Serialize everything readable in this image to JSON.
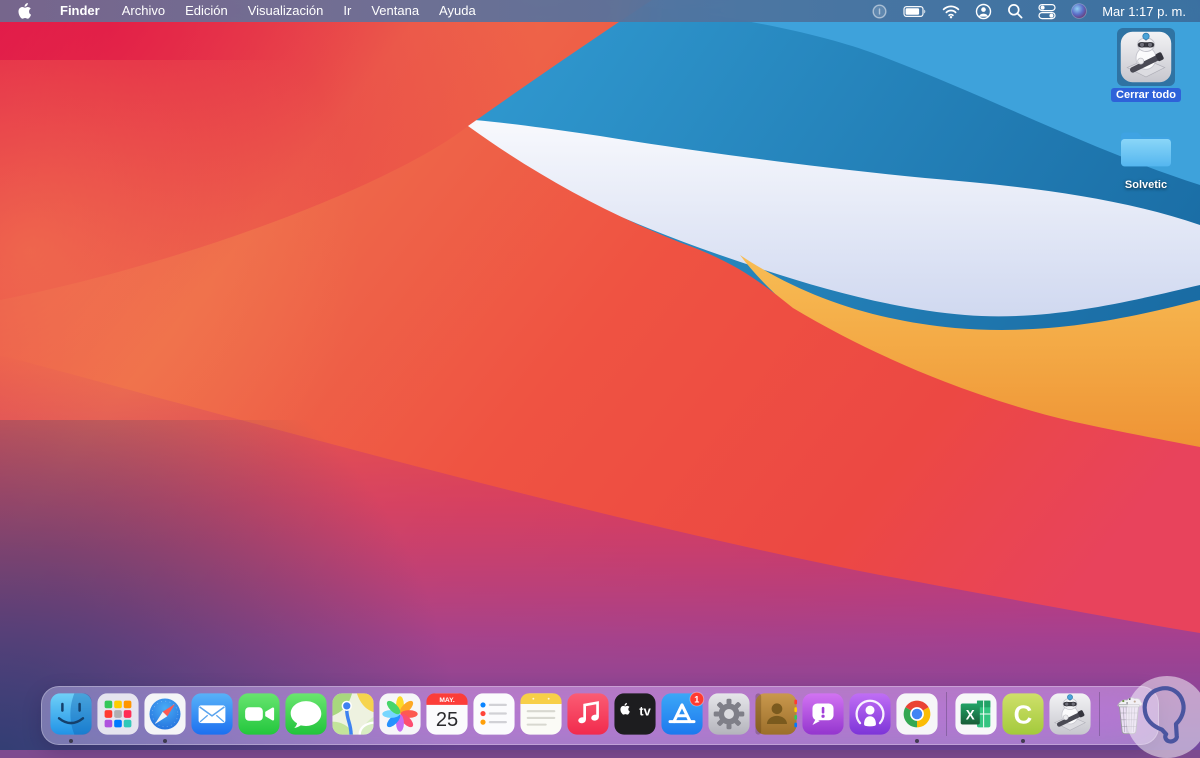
{
  "menubar": {
    "active_app": "Finder",
    "menus": [
      "Finder",
      "Archivo",
      "Edición",
      "Visualización",
      "Ir",
      "Ventana",
      "Ayuda"
    ],
    "status_icons": [
      "dimmed-status-icon",
      "battery-icon",
      "wifi-icon",
      "user-account-icon",
      "spotlight-search-icon",
      "control-center-icon",
      "siri-app-icon"
    ],
    "clock": "Mar 1:17 p. m."
  },
  "desktop": {
    "icons": [
      {
        "label": "Cerrar todo",
        "icon": "automator-app-icon",
        "selected": true
      },
      {
        "label": "Solvetic",
        "icon": "blue-folder-icon",
        "selected": false
      }
    ]
  },
  "dock": {
    "items": [
      {
        "id": "finder",
        "icon": "finder-icon",
        "running": true
      },
      {
        "id": "launchpad",
        "icon": "launchpad-icon",
        "running": false
      },
      {
        "id": "safari",
        "icon": "safari-icon",
        "running": true
      },
      {
        "id": "mail",
        "icon": "mail-icon",
        "running": false
      },
      {
        "id": "facetime",
        "icon": "facetime-icon",
        "running": false
      },
      {
        "id": "messages",
        "icon": "messages-icon",
        "running": false
      },
      {
        "id": "maps",
        "icon": "maps-icon",
        "running": false
      },
      {
        "id": "photos",
        "icon": "photos-icon",
        "running": false
      },
      {
        "id": "calendar",
        "icon": "calendar-icon",
        "running": false,
        "month": "MAY.",
        "day": "25"
      },
      {
        "id": "reminders",
        "icon": "reminders-icon",
        "running": false
      },
      {
        "id": "notes",
        "icon": "notes-icon",
        "running": false
      },
      {
        "id": "music",
        "icon": "music-icon",
        "running": false
      },
      {
        "id": "tv",
        "icon": "apple-tv-icon",
        "running": false,
        "label": "tv"
      },
      {
        "id": "app-store",
        "icon": "app-store-icon",
        "running": false,
        "badge": "1"
      },
      {
        "id": "system-preferences",
        "icon": "system-preferences-icon",
        "running": false
      },
      {
        "id": "contacts",
        "icon": "contacts-icon",
        "running": false
      },
      {
        "id": "feedback-assistant",
        "icon": "feedback-assistant-icon",
        "running": false
      },
      {
        "id": "podcasts",
        "icon": "podcasts-icon",
        "running": false
      },
      {
        "id": "chrome",
        "icon": "chrome-icon",
        "running": true
      },
      {
        "id": "excel",
        "icon": "excel-icon",
        "running": false,
        "letter": "X"
      },
      {
        "id": "camtasia",
        "icon": "camtasia-icon",
        "running": true,
        "letter": "C"
      },
      {
        "id": "automator",
        "icon": "automator-icon",
        "running": false
      },
      {
        "id": "trash",
        "icon": "trash-full-icon",
        "running": false
      }
    ]
  },
  "watermark": {
    "icon": "solvetic-bulb-logo"
  },
  "colors": {
    "selection_blue": "#2E62D9",
    "menubar_text": "#FFFFFF",
    "appstore_badge_red": "#FF3B30",
    "calendar_red": "#FC3D39",
    "wallpaper_blue": "#2387BE",
    "wallpaper_red": "#EE5342",
    "wallpaper_amber": "#F3A843",
    "wallpaper_purple": "#8F4099"
  }
}
